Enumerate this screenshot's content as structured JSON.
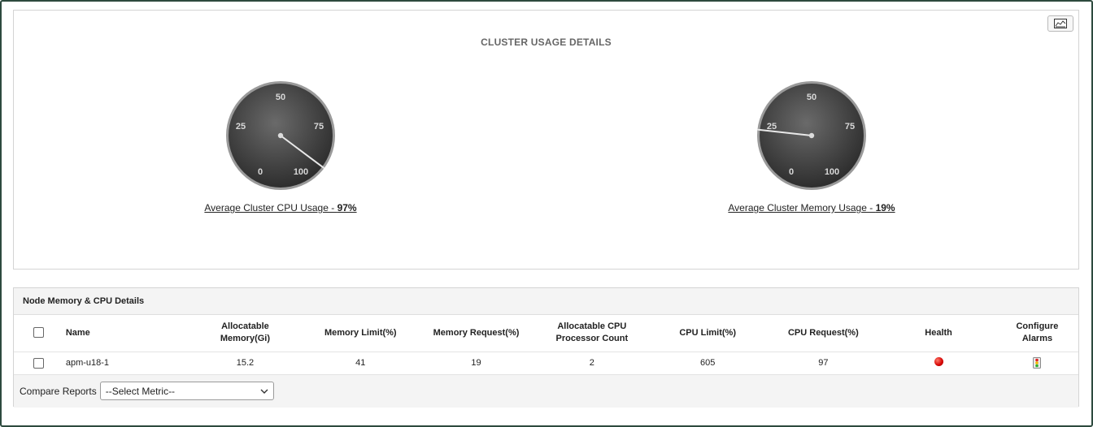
{
  "usage": {
    "title": "CLUSTER USAGE DETAILS",
    "gauges": [
      {
        "ticks": [
          "0",
          "25",
          "50",
          "75",
          "100"
        ],
        "caption_label": "Average Cluster CPU Usage - ",
        "caption_value": "97%",
        "value": 97
      },
      {
        "ticks": [
          "0",
          "25",
          "50",
          "75",
          "100"
        ],
        "caption_label": "Average Cluster Memory Usage - ",
        "caption_value": "19%",
        "value": 19
      }
    ]
  },
  "details": {
    "title": "Node Memory & CPU Details",
    "columns": {
      "name": "Name",
      "alloc_memory": "Allocatable Memory(Gi)",
      "memory_limit": "Memory Limit(%)",
      "memory_request": "Memory Request(%)",
      "alloc_cpu": "Allocatable CPU Processor Count",
      "cpu_limit": "CPU Limit(%)",
      "cpu_request": "CPU Request(%)",
      "health": "Health",
      "configure_alarms": "Configure Alarms"
    },
    "rows": [
      {
        "name": "apm-u18-1",
        "alloc_memory": "15.2",
        "memory_limit": "41",
        "memory_request": "19",
        "alloc_cpu": "2",
        "cpu_limit": "605",
        "cpu_request": "97",
        "health": "critical",
        "health_color": "#e00000"
      }
    ],
    "compare": {
      "label": "Compare Reports",
      "selected": "--Select Metric--"
    }
  },
  "icons": {
    "collapse": "chart-collapse-icon",
    "alarm": "traffic-light-icon",
    "dropdown": "chevron-down-icon"
  }
}
